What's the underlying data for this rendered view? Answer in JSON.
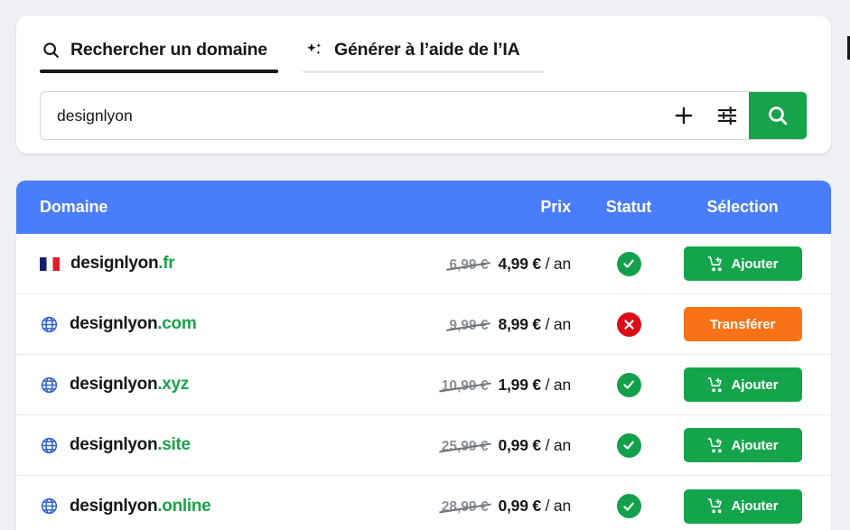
{
  "tabs": [
    {
      "id": "search",
      "label": "Rechercher un domaine",
      "icon": "search-icon",
      "active": true
    },
    {
      "id": "ai",
      "label": "Générer à l’aide de l’IA",
      "icon": "sparkle-ai-icon",
      "active": false
    }
  ],
  "search": {
    "value": "designlyon",
    "placeholder": "designlyon",
    "add_icon": "plus-icon",
    "filter_icon": "sliders-icon",
    "submit_icon": "search-icon"
  },
  "table": {
    "headers": {
      "domain": "Domaine",
      "price": "Prix",
      "status": "Statut",
      "action": "Sélection"
    },
    "rows": [
      {
        "icon": "flag-fr-icon",
        "name": "designlyon",
        "tld": ".fr",
        "price_old": "6,99 €",
        "price_new": "4,99 €",
        "price_period": "/ an",
        "status": "available",
        "status_icon": "check-circle-icon",
        "action_label": "Ajouter",
        "action_icon": "cart-plus-icon",
        "action_type": "add"
      },
      {
        "icon": "globe-icon",
        "name": "designlyon",
        "tld": ".com",
        "price_old": "9,99 €",
        "price_new": "8,99 €",
        "price_period": "/ an",
        "status": "taken",
        "status_icon": "x-circle-icon",
        "action_label": "Transférer",
        "action_icon": "",
        "action_type": "transfer"
      },
      {
        "icon": "globe-icon",
        "name": "designlyon",
        "tld": ".xyz",
        "price_old": "10,99 €",
        "price_new": "1,99 €",
        "price_period": "/ an",
        "status": "available",
        "status_icon": "check-circle-icon",
        "action_label": "Ajouter",
        "action_icon": "cart-plus-icon",
        "action_type": "add"
      },
      {
        "icon": "globe-icon",
        "name": "designlyon",
        "tld": ".site",
        "price_old": "25,99 €",
        "price_new": "0,99 €",
        "price_period": "/ an",
        "status": "available",
        "status_icon": "check-circle-icon",
        "action_label": "Ajouter",
        "action_icon": "cart-plus-icon",
        "action_type": "add"
      },
      {
        "icon": "globe-icon",
        "name": "designlyon",
        "tld": ".online",
        "price_old": "28,99 €",
        "price_new": "0,99 €",
        "price_period": "/ an",
        "status": "available",
        "status_icon": "check-circle-icon",
        "action_label": "Ajouter",
        "action_icon": "cart-plus-icon",
        "action_type": "add"
      }
    ]
  },
  "colors": {
    "accent_green": "#16a34a",
    "header_blue": "#4a7dfc",
    "transfer_orange": "#f97316",
    "status_ok": "#12a04b",
    "status_no": "#dc0d17",
    "tld_green": "#1aa34a",
    "page_bg": "#eef0f3"
  }
}
